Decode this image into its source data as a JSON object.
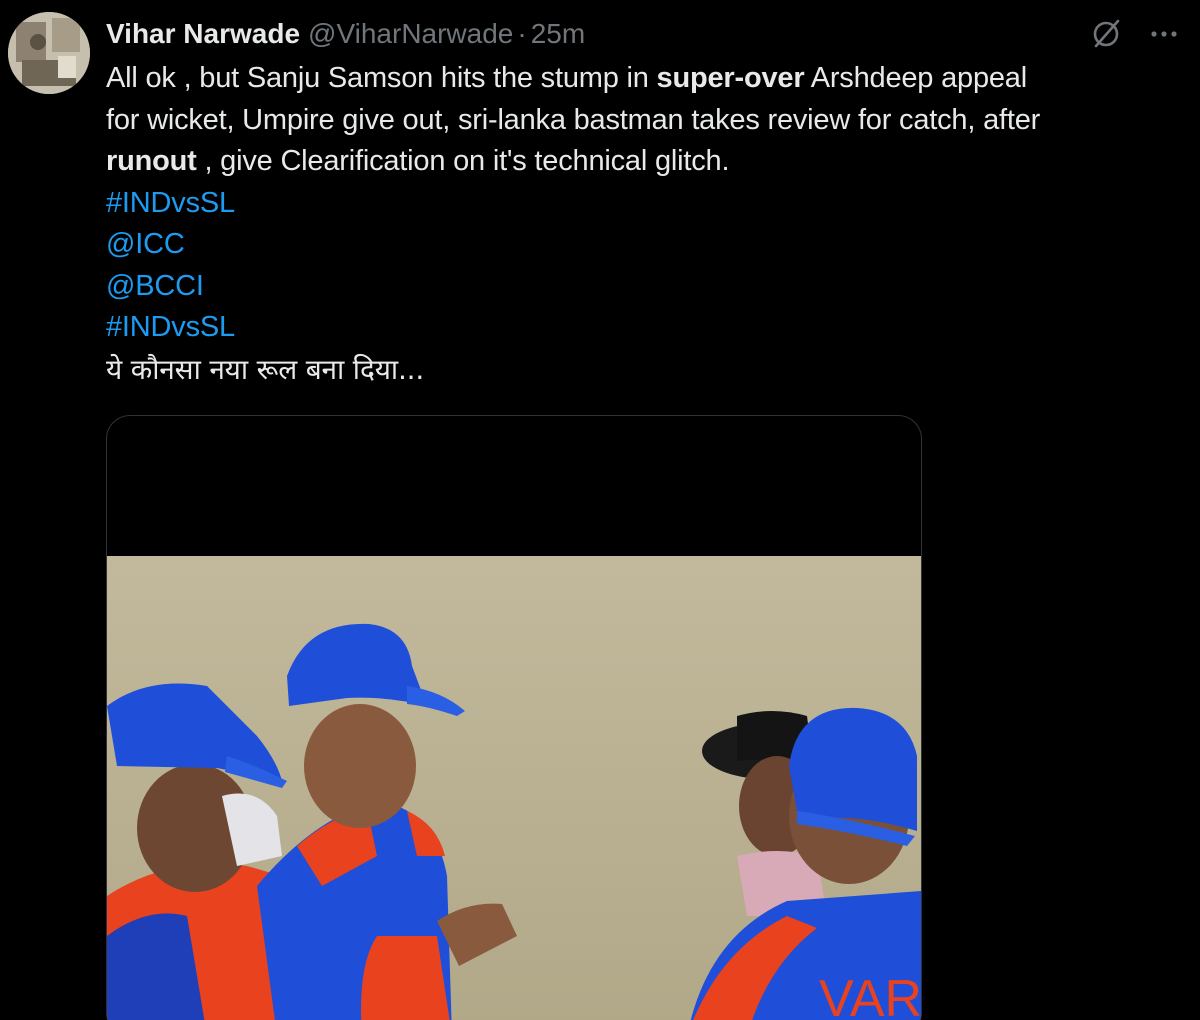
{
  "author": {
    "name": "Vihar Narwade",
    "handle": "@ViharNarwade",
    "separator": "·",
    "time": "25m"
  },
  "actions": {
    "grok_icon": "grok-icon",
    "more_icon": "more-options-icon"
  },
  "tweet": {
    "l1_a": "All ok , but Sanju Samson hits the stump in ",
    "l1_b": "super-over",
    "l1_c": " Arshdeep appeal",
    "l2": "for wicket, Umpire give out, sri-lanka  bastman takes review for catch, after",
    "l3_a": "runout",
    "l3_b": " , give Clearification on  it's technical glitch.",
    "tag1": "#INDvsSL",
    "mention1": "@ICC",
    "mention2": "@BCCI",
    "tag2": "#INDvsSL",
    "hindi": "ये कौनसा  नया  रूल बना दिया..."
  },
  "media": {
    "jersey_text": "VAR"
  },
  "colors": {
    "background": "#000000",
    "text": "#e7e9ea",
    "muted": "#71767b",
    "link": "#1d9bf0",
    "cap_blue": "#1f4fd8",
    "jersey_orange": "#e8421f",
    "field": "#b8ae90"
  }
}
